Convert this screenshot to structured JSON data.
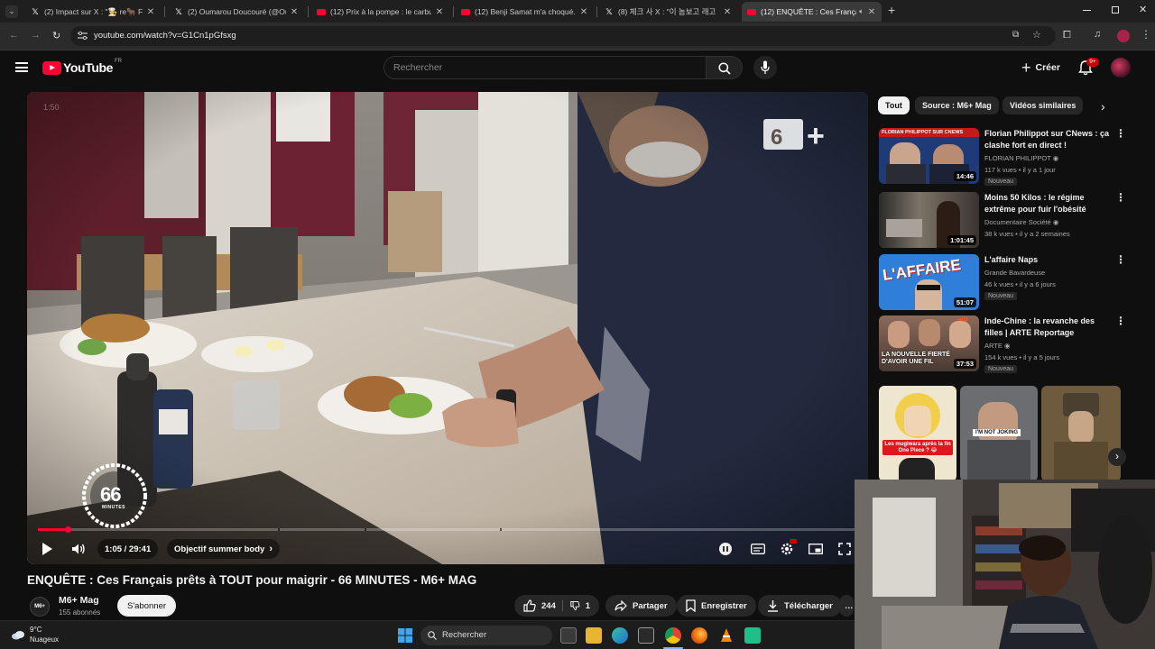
{
  "browser": {
    "tabs": [
      {
        "title": "(2) Impact sur X : \"🧑‍🍳 re🐂 FLA",
        "favicon": "x-icon"
      },
      {
        "title": "(2) Oumarou Doucouré (@Oum",
        "favicon": "x-icon"
      },
      {
        "title": "(12) Prix à la pompe : le carbur",
        "favicon": "youtube-icon"
      },
      {
        "title": "(12) Benji Samat m'a choqué...",
        "favicon": "youtube-icon"
      },
      {
        "title": "(8) 체크 사 X : \"이 놈보고 래고",
        "favicon": "x-icon"
      },
      {
        "title": "(12) ENQUÊTE : Ces Françai",
        "favicon": "youtube-icon",
        "active": true
      }
    ],
    "new_tab": "+",
    "url": "youtube.com/watch?v=G1Cn1pGfsxg"
  },
  "youtube": {
    "logo_text": "YouTube",
    "country_code": "FR",
    "search_placeholder": "Rechercher",
    "create_label": "Créer",
    "notifications_badge": "9+"
  },
  "player": {
    "watermark": "1:50",
    "current_time": "1:05",
    "duration": "29:41",
    "time_display": "1:05 / 29:41",
    "chapter": "Objectif summer body",
    "chapter_arrow": "›",
    "progress_fraction": 0.0365,
    "logo_66": "66",
    "logo_minutes": "MINUTES",
    "channel_logo": "M6+"
  },
  "video": {
    "title": "ENQUÊTE : Ces Français prêts à TOUT pour maigrir - 66 MINUTES - M6+ MAG",
    "channel": "M6+ Mag",
    "channel_avatar_text": "M6+",
    "subscribers": "155 abonnés",
    "subscribe_label": "S'abonner",
    "likes": "244",
    "dislikes": "1",
    "share_label": "Partager",
    "save_label": "Enregistrer",
    "download_label": "Télécharger"
  },
  "sidebar": {
    "chips": [
      "Tout",
      "Source : M6+ Mag",
      "Vidéos similaires"
    ],
    "recommendations": [
      {
        "title": "Florian Philippot sur CNews : ça clashe fort en direct !",
        "channel": "FLORIAN PHILIPPOT",
        "verified": true,
        "meta": "117 k vues • il y a 1 jour",
        "badge": "Nouveau",
        "duration": "14:46",
        "thumb_caption": "FLORIAN PHILIPPOT SUR CNEWS"
      },
      {
        "title": "Moins 50 Kilos : le régime extrême pour fuir l'obésité",
        "channel": "Documentaire Société",
        "verified": true,
        "meta": "38 k vues • il y a 2 semaines",
        "badge": "",
        "duration": "1:01:45",
        "thumb_caption": ""
      },
      {
        "title": "L'affaire Naps",
        "channel": "Grande Bavardeuse",
        "verified": false,
        "meta": "46 k vues • il y a 6 jours",
        "badge": "Nouveau",
        "duration": "51:07",
        "thumb_caption": "L'AFFAIRE"
      },
      {
        "title": "Inde-Chine : la revanche des filles | ARTE Reportage",
        "channel": "ARTE",
        "verified": true,
        "meta": "154 k vues • il y a 5 jours",
        "badge": "Nouveau",
        "duration": "37:53",
        "thumb_caption": "LA NOUVELLE FIERTÉ D'AVOIR UNE FIL"
      }
    ],
    "shorts": [
      {
        "caption": "Les mugiwara après la fin One Piece ? 😂"
      },
      {
        "caption": "I'M NOT JOKING"
      },
      {
        "caption": ""
      }
    ]
  },
  "taskbar": {
    "temperature": "9°C",
    "condition": "Nuageux",
    "search_label": "Rechercher"
  },
  "colors": {
    "accent": "#ff0033",
    "background": "#0f0f0f",
    "chip_bg": "#272727"
  }
}
